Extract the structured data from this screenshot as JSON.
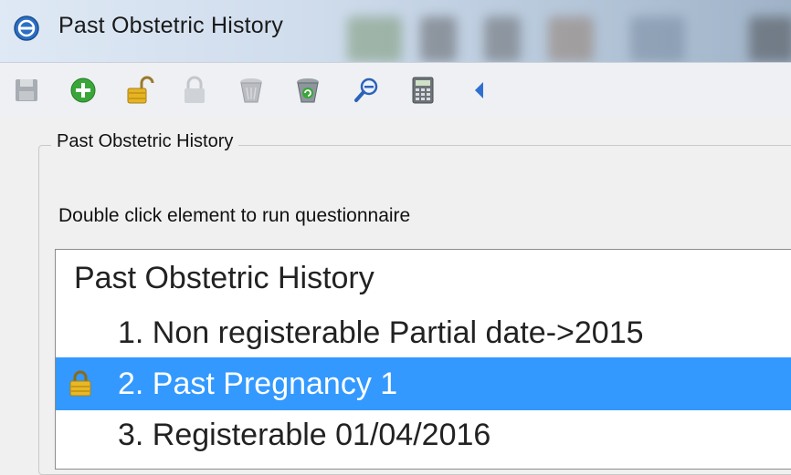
{
  "window": {
    "title": "Past Obstetric History"
  },
  "toolbar": {
    "buttons": [
      {
        "icon": "save-icon",
        "enabled": false
      },
      {
        "icon": "add-icon",
        "enabled": true
      },
      {
        "icon": "unlock-icon",
        "enabled": true
      },
      {
        "icon": "lock-icon",
        "enabled": false
      },
      {
        "icon": "recycle-bin-empty-icon",
        "enabled": false
      },
      {
        "icon": "recycle-bin-restore-icon",
        "enabled": true
      },
      {
        "icon": "zoom-out-icon",
        "enabled": true
      },
      {
        "icon": "calculator-icon",
        "enabled": true
      },
      {
        "icon": "back-arrow-icon",
        "enabled": true
      }
    ]
  },
  "group": {
    "legend": "Past Obstetric History",
    "instruction": "Double click element to run questionnaire"
  },
  "tree": {
    "root": "Past Obstetric History",
    "items": [
      {
        "label": "1. Non registerable Partial date->2015",
        "locked": false,
        "selected": false
      },
      {
        "label": "2. Past Pregnancy 1",
        "locked": true,
        "selected": true
      },
      {
        "label": "3. Registerable 01/04/2016",
        "locked": false,
        "selected": false
      }
    ]
  },
  "colors": {
    "selection": "#3399ff",
    "window_bg": "#f0f0f0"
  }
}
